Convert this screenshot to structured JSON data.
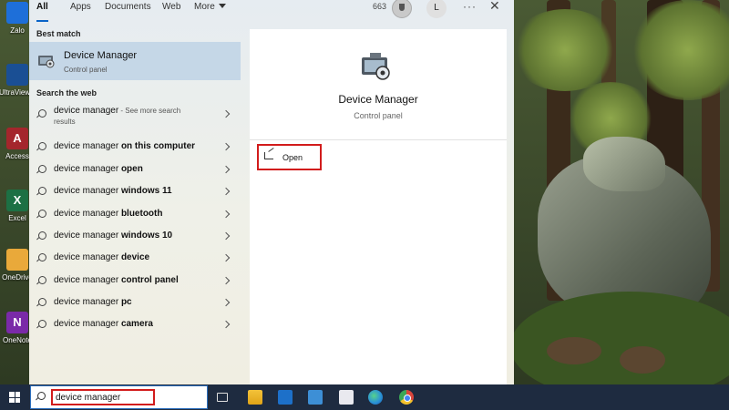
{
  "desktop": {
    "icons": [
      {
        "label": "Zalo",
        "icon": "zalo-icon",
        "color": "#1e6fd9"
      },
      {
        "label": "UltraViewer",
        "icon": "ultraviewer-icon",
        "color": "#1a4f94"
      },
      {
        "label": "Access",
        "icon": "access-icon",
        "color": "#a4262c",
        "letter": "A"
      },
      {
        "label": "Excel",
        "icon": "excel-icon",
        "color": "#1d7044",
        "letter": "X"
      },
      {
        "label": "OneDrive",
        "icon": "onedrive-icon",
        "color": "#e9a93a"
      },
      {
        "label": "OneNote",
        "icon": "onenote-icon",
        "color": "#7a2aa8",
        "letter": "N"
      }
    ]
  },
  "search": {
    "tabs": [
      "All",
      "Apps",
      "Documents",
      "Web",
      "More"
    ],
    "active_tab": "All",
    "points": "663",
    "avatar_initial": "L",
    "more_options": "···",
    "close": "✕",
    "best_match_heading": "Best match",
    "best_match": {
      "title": "Device Manager",
      "subtitle": "Control panel"
    },
    "web_heading": "Search the web",
    "web_results": [
      {
        "prefix": "device manager",
        "bold": "",
        "see_more": " - See more search",
        "see_more_2": "results"
      },
      {
        "prefix": "device manager ",
        "bold": "on this computer"
      },
      {
        "prefix": "device manager ",
        "bold": "open"
      },
      {
        "prefix": "device manager ",
        "bold": "windows 11"
      },
      {
        "prefix": "device manager ",
        "bold": "bluetooth"
      },
      {
        "prefix": "device manager ",
        "bold": "windows 10"
      },
      {
        "prefix": "device manager ",
        "bold": "device"
      },
      {
        "prefix": "device manager ",
        "bold": "control panel"
      },
      {
        "prefix": "device manager ",
        "bold": "pc"
      },
      {
        "prefix": "device manager ",
        "bold": "camera"
      }
    ],
    "details": {
      "title": "Device Manager",
      "subtitle": "Control panel",
      "open_label": "Open"
    }
  },
  "taskbar": {
    "search_value": "device manager",
    "apps": [
      "task-view-icon",
      "file-explorer-icon",
      "mail-icon",
      "photos-icon",
      "todo-icon",
      "edge-icon",
      "chrome-icon"
    ]
  },
  "colors": {
    "accent": "#0a64c8",
    "highlight_box": "#d21c1c",
    "best_match_bg": "#c5d7e7",
    "taskbar": "#1e2b40"
  }
}
